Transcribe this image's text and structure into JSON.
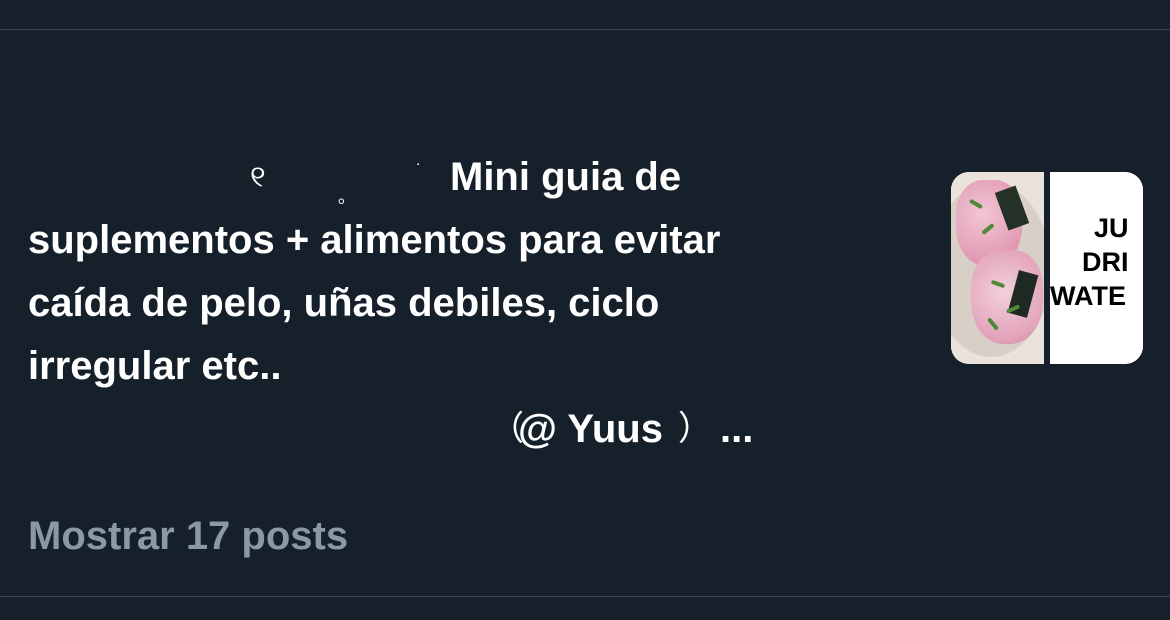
{
  "post": {
    "glyph_a": "୧",
    "glyph_b": "｡",
    "glyph_c": "˙",
    "line1": "Mini guia de",
    "line2": "suplementos + alimentos para evitar",
    "line3": "caída de pelo, uñas debiles, ciclo",
    "line4": "irregular etc..",
    "handle_open": "（",
    "handle": "@ Yuus",
    "handle_close": "）",
    "ellipsis": "..."
  },
  "show_more": "Mostrar 17 posts",
  "thumbnail": {
    "words": [
      "JU",
      "DRI",
      "WATE"
    ]
  },
  "colors": {
    "background": "#15202b",
    "text": "#ffffff",
    "muted": "#8b98a5",
    "divider": "#38444d"
  }
}
